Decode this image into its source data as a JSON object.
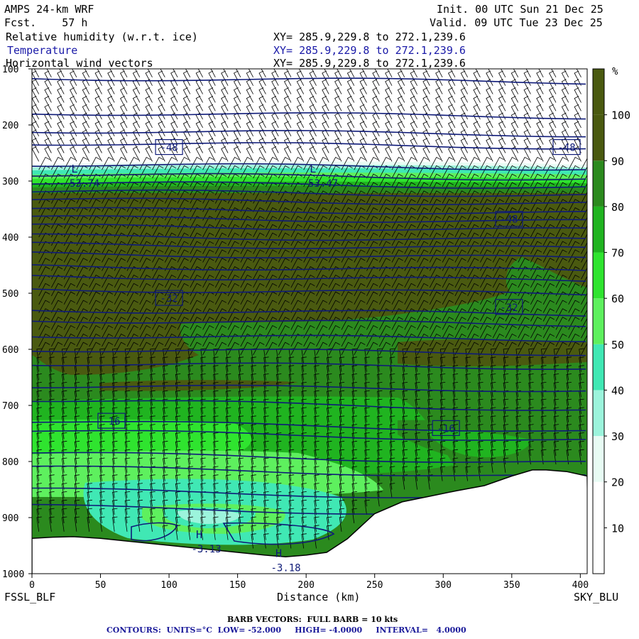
{
  "header": {
    "model": "AMPS 24-km WRF",
    "fcst": "Fcst.    57 h",
    "init": "Init. 00 UTC Sun 21 Dec 25",
    "valid": "Valid. 09 UTC Tue 23 Dec 25",
    "field1": "Relative humidity (w.r.t. ice)",
    "field2": "Temperature",
    "field3": "Horizontal wind vectors",
    "xy1": "XY= 285.9,229.8 to 272.1,239.6",
    "xy2": "XY= 285.9,229.8 to 272.1,239.6",
    "xy3": "XY= 285.9,229.8 to 272.1,239.6"
  },
  "footer": {
    "barb": "BARB VECTORS:  FULL BARB = 10 kts",
    "contours": "CONTOURS:  UNITS=°C  LOW= -52.000     HIGH= -4.0000     INTERVAL=   4.0000"
  },
  "colors": {
    "rh_90_100": "#4a5a10",
    "rh_80_90": "#2b8a1e",
    "rh_70_80": "#20b420",
    "rh_60_70": "#2fe42f",
    "rh_50_60": "#5ef05e",
    "rh_40_50": "#40e8b4",
    "rh_30_40": "#9cf4dc",
    "rh_20_30": "#e8fcf4",
    "rh_10_20": "#ffffff",
    "contour": "#0f1b78",
    "barb": "#000000"
  },
  "chart_data": {
    "type": "cross-section",
    "xlabel": "Distance (km)",
    "ylabel": "",
    "xlim": [
      0,
      405
    ],
    "ylim": [
      1000,
      100
    ],
    "x_ticks": [
      0,
      50,
      100,
      150,
      200,
      250,
      300,
      350,
      400
    ],
    "y_ticks": [
      100,
      200,
      300,
      400,
      500,
      600,
      700,
      800,
      900,
      1000
    ],
    "left_end_label": "FSSL_BLF",
    "right_end_label": "SKY_BLU",
    "colorbar": {
      "unit": "%",
      "tick_labels": [
        10,
        20,
        30,
        40,
        50,
        60,
        70,
        80,
        90,
        100
      ]
    },
    "isotherm_labels": [
      {
        "text": "-48",
        "x": 100,
        "p": 240
      },
      {
        "text": "-48",
        "x": 390,
        "p": 240
      },
      {
        "text": "-48",
        "x": 348,
        "p": 368
      },
      {
        "text": "-32",
        "x": 100,
        "p": 509
      },
      {
        "text": "-32",
        "x": 348,
        "p": 525
      },
      {
        "text": "-16",
        "x": 58,
        "p": 728
      },
      {
        "text": "-16",
        "x": 302,
        "p": 741
      }
    ],
    "extrema": [
      {
        "symbol": "L",
        "value": "-53.74",
        "x": 31,
        "p": 285
      },
      {
        "symbol": "L",
        "value": "-53.47",
        "x": 205,
        "p": 285
      },
      {
        "symbol": "H",
        "value": "-3.13",
        "x": 122,
        "p": 937
      },
      {
        "symbol": "H",
        "value": "-3.18",
        "x": 180,
        "p": 970
      }
    ]
  }
}
